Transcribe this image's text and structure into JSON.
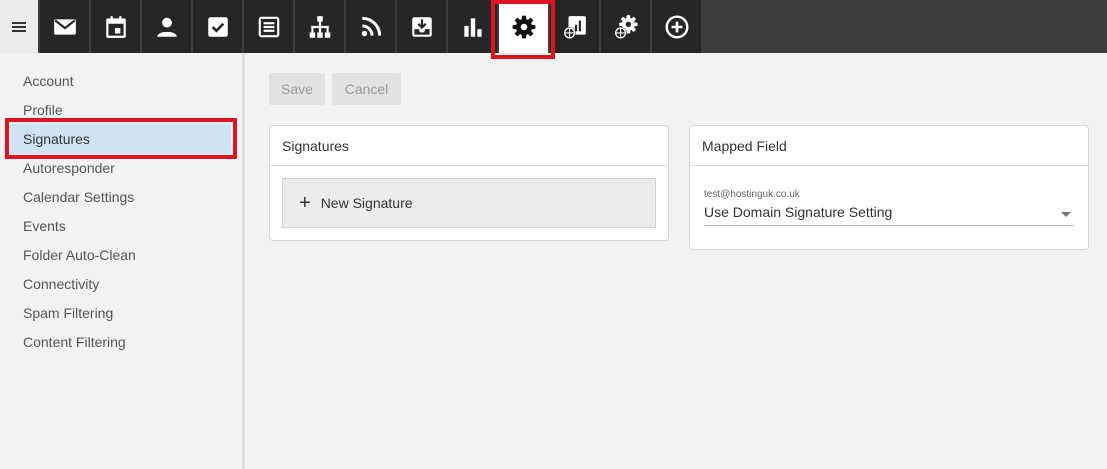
{
  "topnav": {
    "items": [
      {
        "icon": "menu-icon"
      },
      {
        "icon": "mail-icon"
      },
      {
        "icon": "calendar-icon"
      },
      {
        "icon": "contacts-icon"
      },
      {
        "icon": "tasks-icon"
      },
      {
        "icon": "notes-icon"
      },
      {
        "icon": "sitemap-icon"
      },
      {
        "icon": "rss-icon"
      },
      {
        "icon": "archive-icon"
      },
      {
        "icon": "reports-icon"
      },
      {
        "icon": "settings-icon",
        "active": true
      },
      {
        "icon": "domain-reports-icon"
      },
      {
        "icon": "domain-settings-icon"
      },
      {
        "icon": "add-icon"
      }
    ]
  },
  "sidebar": {
    "items": [
      {
        "label": "Account"
      },
      {
        "label": "Profile"
      },
      {
        "label": "Signatures",
        "active": true
      },
      {
        "label": "Autoresponder"
      },
      {
        "label": "Calendar Settings"
      },
      {
        "label": "Events"
      },
      {
        "label": "Folder Auto-Clean"
      },
      {
        "label": "Connectivity"
      },
      {
        "label": "Spam Filtering"
      },
      {
        "label": "Content Filtering"
      }
    ]
  },
  "toolbar": {
    "save_label": "Save",
    "cancel_label": "Cancel"
  },
  "signatures_card": {
    "title": "Signatures",
    "new_signature_label": "New Signature"
  },
  "mapped_card": {
    "title": "Mapped Field",
    "field_label": "test@hostinguk.co.uk",
    "field_value": "Use Domain Signature Setting"
  },
  "colors": {
    "topbar": "#3d3d3d",
    "nav_button": "#262626",
    "highlight": "#e0141e",
    "active_side": "#cfe4f2"
  }
}
